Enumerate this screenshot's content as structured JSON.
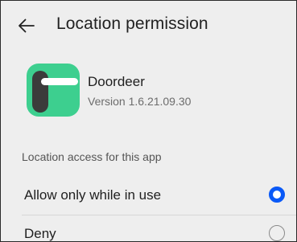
{
  "header": {
    "back_icon": "arrow-left-icon",
    "title": "Location permission"
  },
  "app": {
    "name": "Doordeer",
    "version": "Version 1.6.21.09.30",
    "icon": "doordeer-app-icon",
    "icon_bg_color": "#3dcf8f",
    "icon_fg_color": "#3b3b3b"
  },
  "section": {
    "label": "Location access for this app"
  },
  "options": [
    {
      "label": "Allow only while in use",
      "selected": true
    },
    {
      "label": "Deny",
      "selected": false
    }
  ],
  "colors": {
    "accent": "#0a59f7",
    "background": "#eeeeee"
  }
}
